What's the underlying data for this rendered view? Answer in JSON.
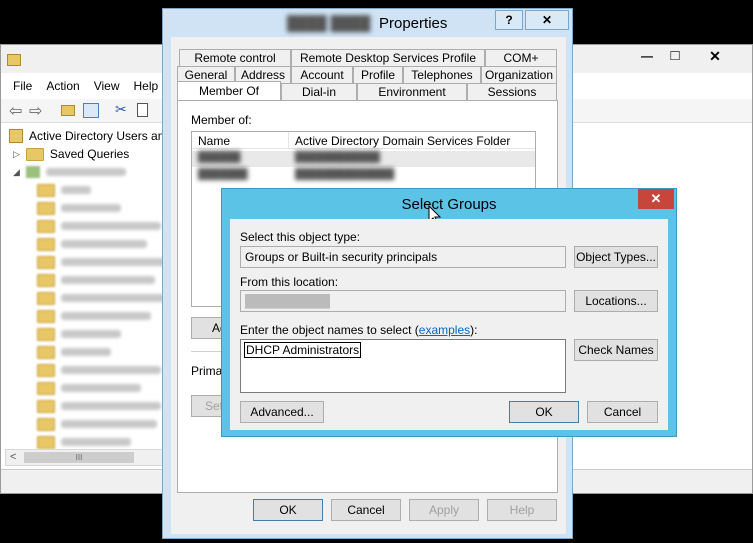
{
  "mmc": {
    "menu": [
      "File",
      "Action",
      "View",
      "Help"
    ],
    "tree_root": "Active Directory Users and",
    "saved_queries": "Saved Queries",
    "scroll_left": "<",
    "scroll_thumb": "III",
    "minimize": "—",
    "maximize": "□",
    "close": "✕"
  },
  "properties": {
    "title_blurred": "████ ████",
    "title": "Properties",
    "help": "?",
    "close": "✕",
    "tabs_row1": [
      "Remote control",
      "Remote Desktop Services Profile",
      "COM+"
    ],
    "tabs_row2": [
      "General",
      "Address",
      "Account",
      "Profile",
      "Telephones",
      "Organization"
    ],
    "tabs_row3": [
      "Member Of",
      "Dial-in",
      "Environment",
      "Sessions"
    ],
    "member_of_label": "Member of:",
    "columns": [
      "Name",
      "Active Directory Domain Services Folder"
    ],
    "rows": [
      [
        "██████",
        "████████████"
      ],
      [
        "███████",
        "██████████████"
      ]
    ],
    "add_partial": "Ad",
    "primary_partial": "Primary",
    "set_partial": "Set",
    "buttons": {
      "ok": "OK",
      "cancel": "Cancel",
      "apply": "Apply",
      "help": "Help"
    }
  },
  "select_groups": {
    "title": "Select Groups",
    "close": "✕",
    "object_type_label": "Select this object type:",
    "object_type_value": "Groups or Built-in security principals",
    "object_types_button": "Object Types...",
    "location_label": "From this location:",
    "location_value": "██████████",
    "locations_button": "Locations...",
    "names_label": "Enter the object names to select (",
    "names_link": "examples",
    "names_label_end": "):",
    "names_value": "DHCP Administrators",
    "check_names_button": "Check Names",
    "advanced_button": "Advanced...",
    "ok_button": "OK",
    "cancel_button": "Cancel"
  }
}
